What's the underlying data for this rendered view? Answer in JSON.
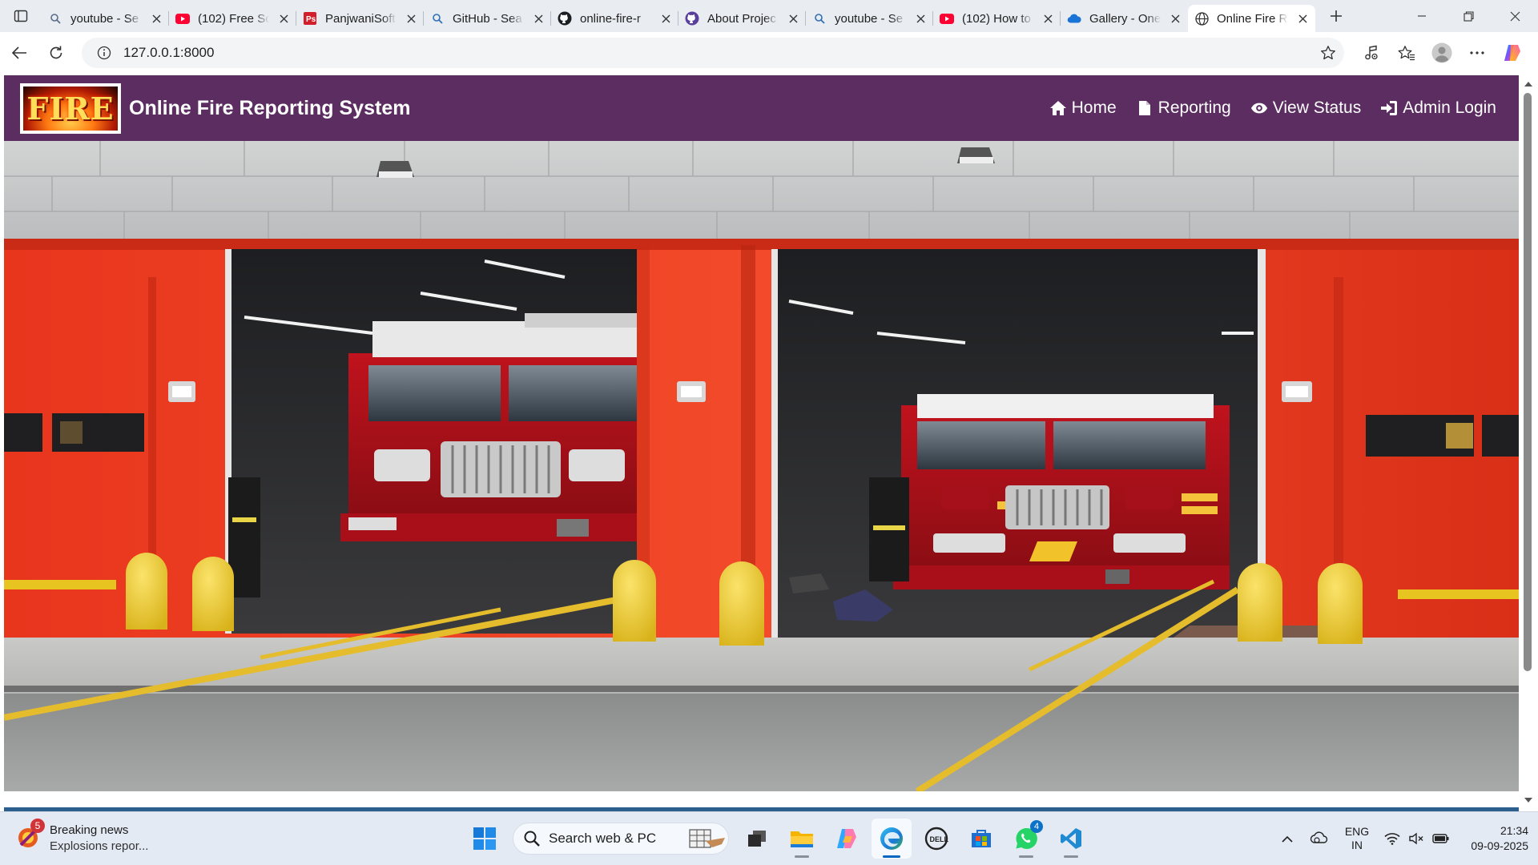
{
  "browser": {
    "tabs": [
      {
        "title": "youtube - Se",
        "icon": "search-icon"
      },
      {
        "title": "(102) Free Sc",
        "icon": "youtube-icon"
      },
      {
        "title": "PanjwaniSoft",
        "icon": "panjwanisoft-icon"
      },
      {
        "title": "GitHub - Sea",
        "icon": "search-icon"
      },
      {
        "title": "online-fire-r",
        "icon": "github-icon"
      },
      {
        "title": "About Projec",
        "icon": "github-icon"
      },
      {
        "title": "youtube - Se",
        "icon": "search-icon"
      },
      {
        "title": "(102) How to",
        "icon": "youtube-icon"
      },
      {
        "title": "Gallery - One",
        "icon": "onedrive-icon"
      },
      {
        "title": "Online Fire R",
        "icon": "globe-icon",
        "active": true
      }
    ],
    "url": "127.0.0.1:8000"
  },
  "site": {
    "logo_text": "FIRE",
    "brand": "Online Fire Reporting System",
    "nav": [
      {
        "label": "Home",
        "icon": "home-icon"
      },
      {
        "label": "Reporting",
        "icon": "document-icon"
      },
      {
        "label": "View Status",
        "icon": "eye-icon"
      },
      {
        "label": "Admin Login",
        "icon": "sign-in-icon"
      }
    ],
    "hero_image": "fire-station-with-two-fire-trucks",
    "colors": {
      "navbar": "#5b2d61",
      "accent_band": "#2d5f8e"
    }
  },
  "taskbar": {
    "news": {
      "badge": "5",
      "title": "Breaking news",
      "subtitle": "Explosions repor..."
    },
    "search_placeholder": "Search web & PC",
    "whatsapp_badge": "4",
    "language": {
      "line1": "ENG",
      "line2": "IN"
    },
    "time": "21:34",
    "date": "09-09-2025"
  }
}
